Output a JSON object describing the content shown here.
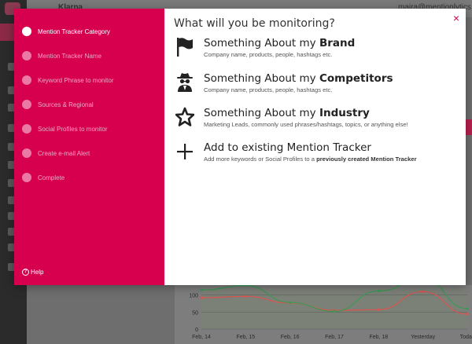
{
  "modal": {
    "question": "What will you be monitoring?",
    "close_icon": "×",
    "steps": [
      {
        "label": "Mention Tracker Category",
        "active": true
      },
      {
        "label": "Mention Tracker Name",
        "active": false
      },
      {
        "label": "Keyword Phrase to monitor",
        "active": false
      },
      {
        "label": "Sources & Regional",
        "active": false
      },
      {
        "label": "Social Profiles to monitor",
        "active": false
      },
      {
        "label": "Create e-mail Alert",
        "active": false
      },
      {
        "label": "Complete",
        "active": false
      }
    ],
    "help_label": "Help",
    "help_icon": "?",
    "options": [
      {
        "icon": "flag-icon",
        "title_prefix": "Something About my ",
        "title_bold": "Brand",
        "desc": "Company name, products, people, hashtags etc."
      },
      {
        "icon": "spy-icon",
        "title_prefix": "Something About my ",
        "title_bold": "Competitors",
        "desc": "Company name, products, people, hashtags etc."
      },
      {
        "icon": "star-icon",
        "title_prefix": "Something About my ",
        "title_bold": "Industry",
        "desc": "Marketing Leads, commonly used phrases/hashtags, topics, or anything else!"
      },
      {
        "icon": "plus-icon",
        "title_prefix": "Add to existing Mention Tracker",
        "title_bold": "",
        "desc": "Add more keywords or Social Profiles to a ",
        "desc_bold": "previously created Mention Tracker"
      }
    ]
  },
  "background": {
    "app_name": "Klarna",
    "user_email": "maira@mentionlytics.com",
    "chart_data": {
      "type": "line",
      "categories": [
        "Feb, 14",
        "Feb, 15",
        "Feb, 16",
        "Feb, 17",
        "Feb, 18",
        "Yesterday",
        "Today"
      ],
      "series": [
        {
          "values": [
            92,
            96,
            77,
            55,
            57,
            110,
            44
          ]
        },
        {
          "values": [
            115,
            128,
            78,
            52,
            112,
            148,
            60
          ]
        }
      ],
      "yticks": [
        "100",
        "50",
        "0"
      ],
      "ylim": [
        0,
        120
      ],
      "colors": [
        "#d9534f",
        "#3a9a55"
      ]
    }
  }
}
